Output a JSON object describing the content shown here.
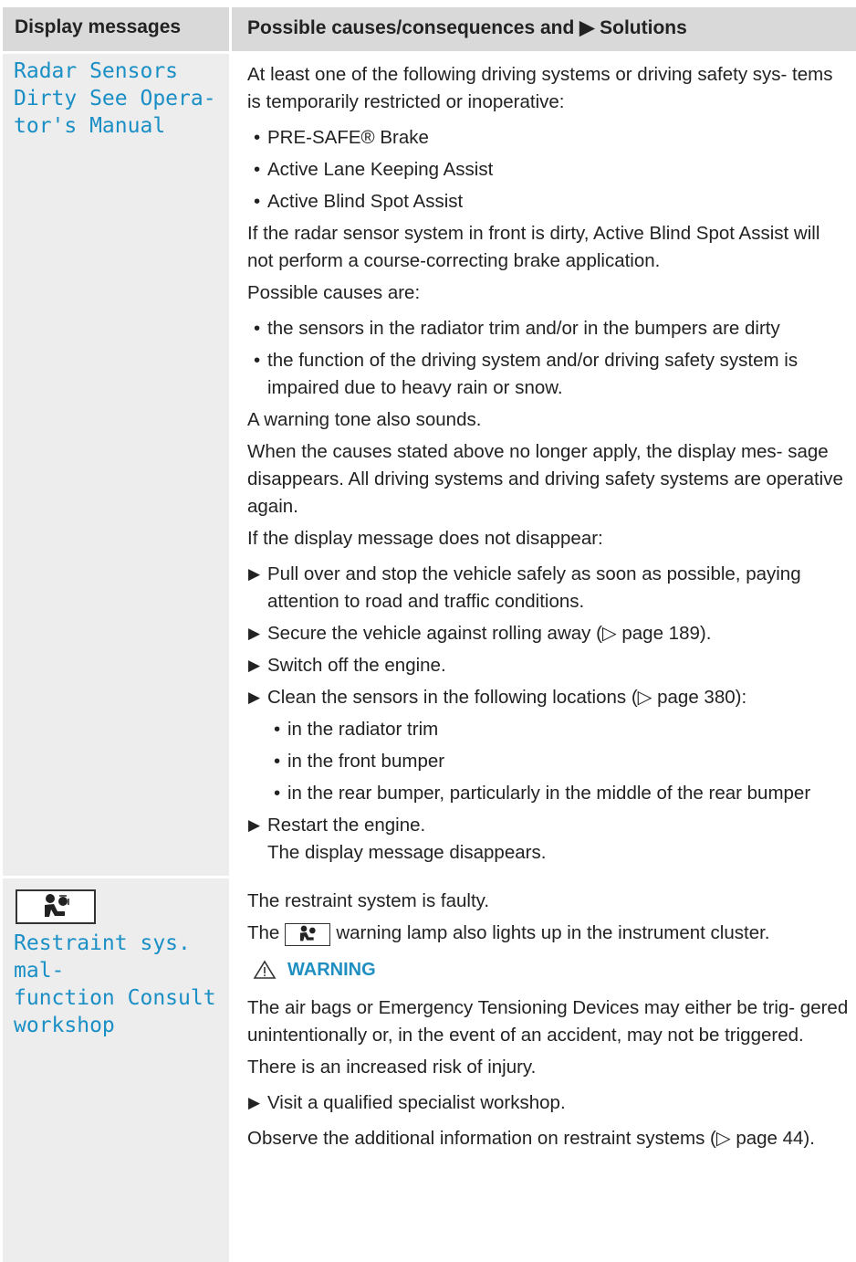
{
  "header": {
    "col1": "Display messages",
    "col2": "Possible causes/consequences and ▶ Solutions"
  },
  "row1": {
    "message": "Radar Sensors Dirty See Opera- tor's Manual",
    "message_lines": [
      "Radar Sensors",
      "Dirty See Opera-",
      "tor's Manual"
    ],
    "intro": "At least one of the following driving systems or driving safety sys- tems is temporarily restricted or inoperative:",
    "systems": [
      "PRE-SAFE® Brake",
      "Active Lane Keeping Assist",
      "Active Blind Spot Assist"
    ],
    "radar_note": "If the radar sensor system in front is dirty, Active Blind Spot Assist will not perform a course-correcting brake application.",
    "causes_heading": "Possible causes are:",
    "causes": [
      "the sensors in the radiator trim and/or in the bumpers are dirty",
      "the function of the driving system and/or driving safety system is impaired due to heavy rain or snow."
    ],
    "tone": "A warning tone also sounds.",
    "recovery": "When the causes stated above no longer apply, the display mes- sage disappears. All driving systems and driving safety systems are operative again.",
    "if_not": "If the display message does not disappear:",
    "steps": [
      "Pull over and stop the vehicle safely as soon as possible, paying attention to road and traffic conditions.",
      "Secure the vehicle against rolling away (▷ page 189).",
      "Switch off the engine.",
      "Clean the sensors in the following locations (▷ page 380):"
    ],
    "locations": [
      "in the radiator trim",
      "in the front bumper",
      "in the rear bumper, particularly in the middle of the rear bumper"
    ],
    "restart": "Restart the engine.",
    "result": "The display message disappears."
  },
  "row2": {
    "icon": "airbag-warning-icon",
    "message": "Restraint sys. mal- function Consult workshop",
    "message_lines": [
      "Restraint sys. mal-",
      "function Consult",
      "workshop"
    ],
    "faulty": "The restraint system is faulty.",
    "lamp_pre": "The",
    "lamp_post": "warning lamp also lights up in the instrument cluster.",
    "warning_label": "WARNING",
    "warning_text": "The air bags or Emergency Tensioning Devices may either be trig- gered unintentionally or, in the event of an accident, may not be triggered.",
    "risk": "There is an increased risk of injury.",
    "action": "Visit a qualified specialist workshop.",
    "observe": "Observe the additional information on restraint systems (▷ page 44)."
  },
  "colors": {
    "accent": "#1a8fc5",
    "header_bg": "#d9d9d9",
    "col1_bg": "#ededed"
  }
}
